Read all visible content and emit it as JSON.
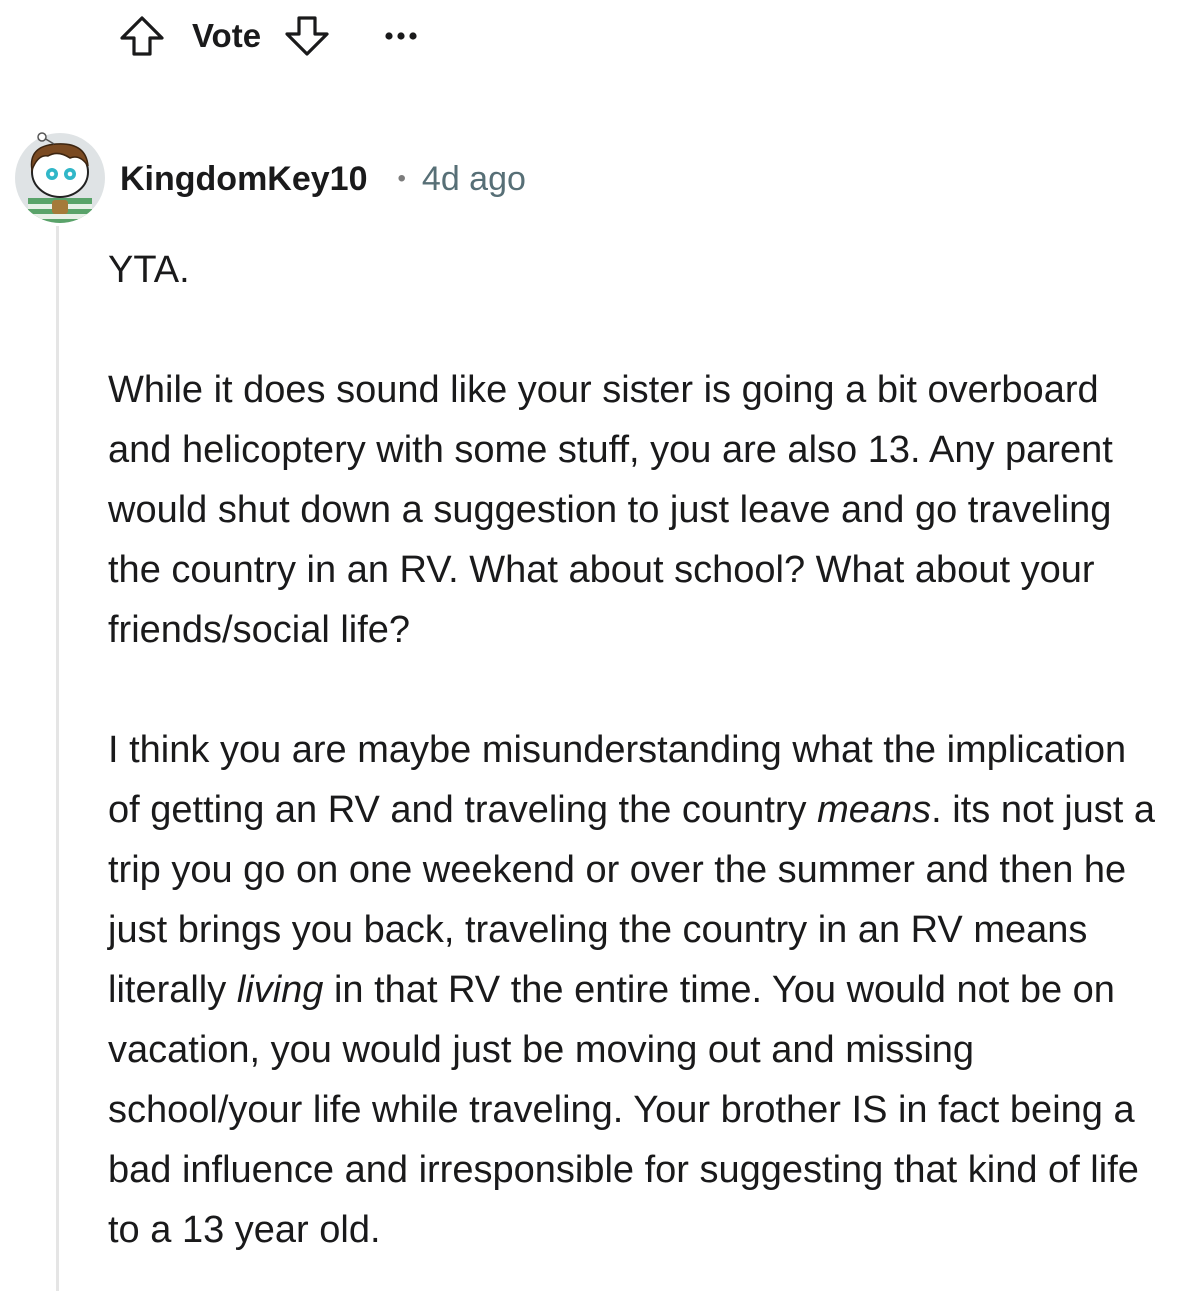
{
  "action_bar": {
    "vote_label": "Vote",
    "upvote_icon": "upvote-arrow-icon",
    "downvote_icon": "downvote-arrow-icon",
    "more_icon": "more-options-icon"
  },
  "comment": {
    "username": "KingdomKey10",
    "separator": "•",
    "timestamp": "4d ago",
    "avatar_icon": "user-avatar-icon",
    "p1": "YTA.",
    "p2": "While it does sound like your sister is going a bit overboard and helicoptery with some stuff, you are also 13. Any parent would shut down a suggestion to just leave and go traveling the country in an RV. What about school? What about your friends/social life?",
    "p3_a": "I think you are maybe misunderstanding what the implication of getting an RV and traveling the country ",
    "p3_em1": "means",
    "p3_b": ". its not just a trip you go on one weekend or over the summer and then he just brings you back, traveling the country in an RV means literally ",
    "p3_em2": "living",
    "p3_c": " in that RV the entire time. You would not be on vacation, you would just be moving out and missing school/your life while traveling. Your brother IS in fact being a bad influence and irresponsible for suggesting that kind of life to a 13 year old."
  },
  "colors": {
    "text": "#1a1a1b",
    "meta": "#576f76",
    "thread_line": "#e5e5e5"
  }
}
